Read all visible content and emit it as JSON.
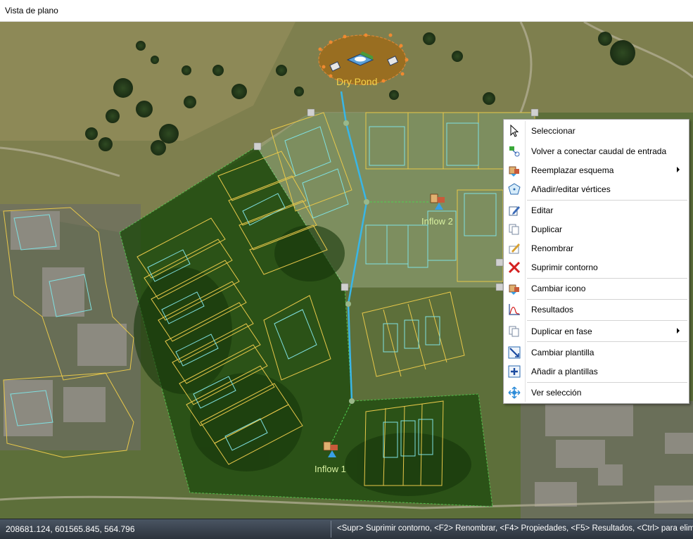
{
  "window": {
    "title": "Vista de plano"
  },
  "map": {
    "labels": {
      "dry_pond": "Dry Pond",
      "inflow_1": "Inflow 1",
      "inflow_2": "Inflow 2"
    }
  },
  "context_menu": {
    "items": [
      {
        "label": "Seleccionar",
        "icon": "cursor-icon"
      },
      {
        "label": "Volver a conectar caudal de entrada",
        "icon": "reconnect-icon"
      },
      {
        "label": "Reemplazar esquema",
        "icon": "replace-scheme-icon",
        "submenu": true
      },
      {
        "label": "Añadir/editar vértices",
        "icon": "vertices-icon"
      },
      {
        "label": "Editar",
        "icon": "edit-icon"
      },
      {
        "label": "Duplicar",
        "icon": "duplicate-icon"
      },
      {
        "label": "Renombrar",
        "icon": "rename-icon"
      },
      {
        "label": "Suprimir contorno",
        "icon": "delete-icon"
      },
      {
        "label": "Cambiar icono",
        "icon": "change-icon-icon"
      },
      {
        "label": "Resultados",
        "icon": "results-icon"
      },
      {
        "label": "Duplicar en fase",
        "icon": "duplicate-phase-icon",
        "submenu": true
      },
      {
        "label": "Cambiar plantilla",
        "icon": "change-template-icon"
      },
      {
        "label": "Añadir a plantillas",
        "icon": "add-template-icon"
      },
      {
        "label": "Ver selección",
        "icon": "view-selection-icon"
      }
    ]
  },
  "status_bar": {
    "coordinates": "208681.124, 601565.845, 564.796",
    "hint": "<Supr> Suprimir contorno, <F2> Renombrar, <F4> Propiedades, <F5> Resultados, <Ctrl> para eliminar"
  },
  "colors": {
    "flow_line": "#39b6e6",
    "label_text": "#d8f0a0",
    "dry_pond_label": "#f5d24a",
    "parcel_outline": "#e8c84a",
    "building_outline": "#7fe0e0",
    "catchment_fill": "#1e5a10"
  }
}
